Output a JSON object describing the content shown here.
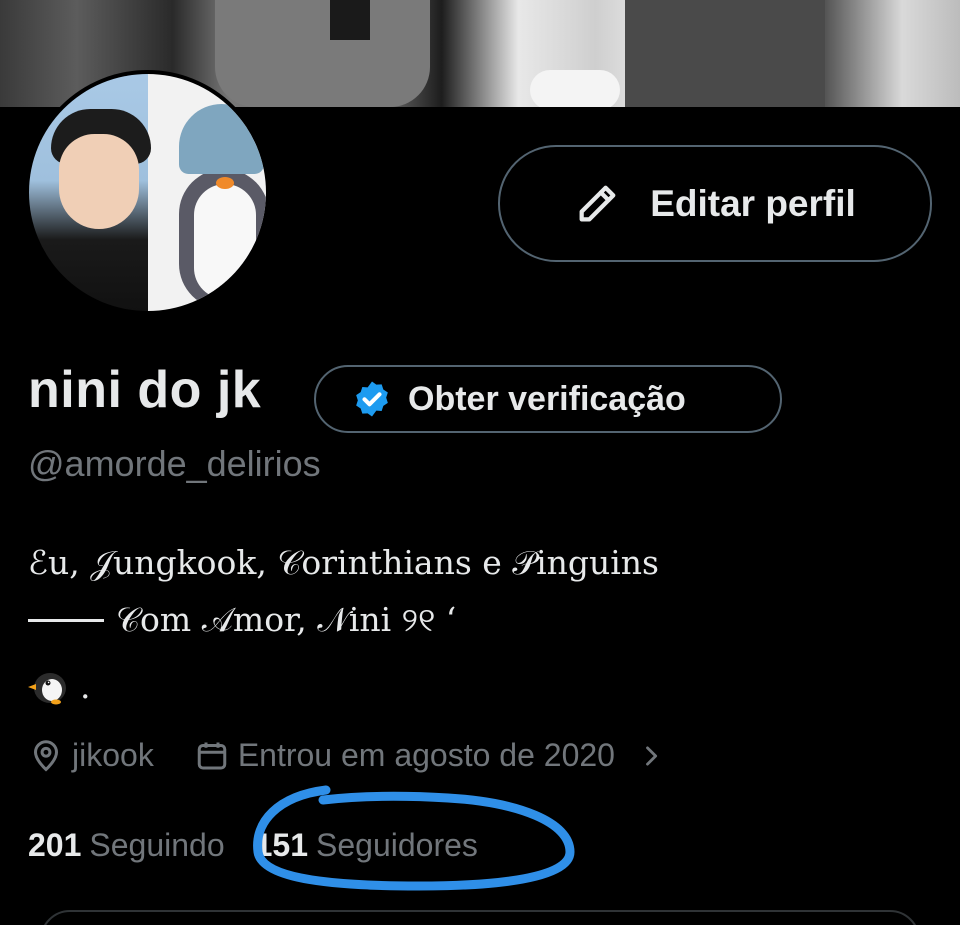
{
  "profile": {
    "name": "nini do jk",
    "handle": "@amorde_delirios",
    "edit_label": "Editar perfil",
    "verify_label": "Obter verificação",
    "bio": {
      "line1": "ℰu, 𝒥ungkook, 𝒞orinthians e 𝒫inguins",
      "line2": "𝒞om 𝒜mor, 𝒩ini ୨୧ ‘",
      "line3": "."
    },
    "location": "jikook",
    "joined": "Entrou em agosto de 2020",
    "following_count": "201",
    "following_label": "Seguindo",
    "followers_count": "151",
    "followers_label": "Seguidores"
  },
  "colors": {
    "background": "#000000",
    "text": "#e7e9ea",
    "muted": "#71767b",
    "verified_blue": "#1d9bf0",
    "highlight_annotation": "#2f8fe8"
  },
  "icons": [
    "pencil-icon",
    "verified-badge-icon",
    "location-pin-icon",
    "calendar-icon",
    "chevron-right-icon",
    "penguin-emoji-icon"
  ]
}
